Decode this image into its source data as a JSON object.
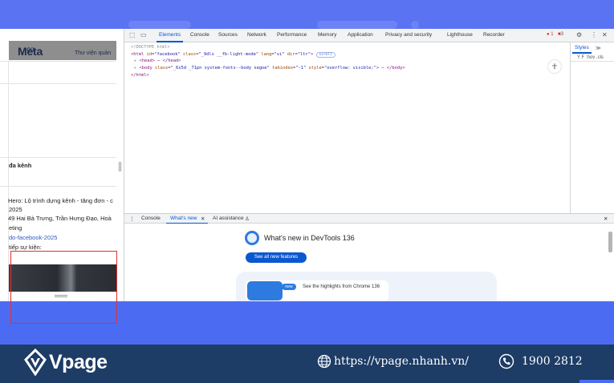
{
  "page": {
    "logo_text": "Meta",
    "logo_inf": "∞",
    "sub_title": "Thư viện quản",
    "lines": [
      "đa kênh",
      "Hero: Lộ trình dựng kênh - tăng đơn - c",
      "2025",
      "49 Hai Bà Trưng, Trần Hưng Đạo, Hoà",
      "eting",
      "do-facebook-2025",
      "tiếp sự kiện:"
    ]
  },
  "devtools": {
    "tabs": [
      "Elements",
      "Console",
      "Sources",
      "Network",
      "Performance",
      "Memory",
      "Application",
      "Privacy and security",
      "Lighthouse",
      "Recorder"
    ],
    "active_tab": "Elements",
    "errors": "1",
    "warnings": "3",
    "dom": {
      "doctype": "<!DOCTYPE html>",
      "html_open": "<html",
      "html_attrs": [
        {
          "name": "id",
          "value": "\"facebook\""
        },
        {
          "name": "class",
          "value": "\"_9dls __fb-light-mode\""
        },
        {
          "name": "lang",
          "value": "\"vi\""
        },
        {
          "name": "dir",
          "value": "\"ltr\""
        }
      ],
      "scroll_chip": "scroll",
      "head_line": "<head> ⋯ </head>",
      "body_open": "<body",
      "body_attrs": [
        {
          "name": "class",
          "value": "\"_6s5d _71pn system-fonts--body segoe\""
        },
        {
          "name": "tabindex",
          "value": "\"-1\""
        },
        {
          "name": "style",
          "value": "\"overflow: visible;\""
        }
      ],
      "body_close": "> ⋯ </body>",
      "html_close": "</html>"
    },
    "styles_tab": "Styles",
    "styles_more": "≫",
    "styles_filter": "Y  F  :hov  .cls",
    "drawer_tabs": [
      "Console",
      "What's new",
      "AI assistance"
    ],
    "drawer_active": "What's new",
    "whats_new": {
      "title": "What's new in DevTools 136",
      "button": "See all new features",
      "badge": "new",
      "highlight": "See the highlights from Chrome 136"
    }
  },
  "footer": {
    "brand": "Vpage",
    "website": "https://vpage.nhanh.vn/",
    "phone": "1900 2812"
  },
  "icons": {
    "inspect": "inspect-element-icon",
    "device": "device-toggle-icon",
    "settings": "gear-icon",
    "more": "more-vertical-icon",
    "close": "close-icon",
    "globe": "globe-icon",
    "phone": "phone-icon"
  },
  "colors": {
    "background": "#4b6cf2",
    "footer": "#1d3c66",
    "accent": "#0b57d0",
    "highlight_box": "#e0302d"
  }
}
